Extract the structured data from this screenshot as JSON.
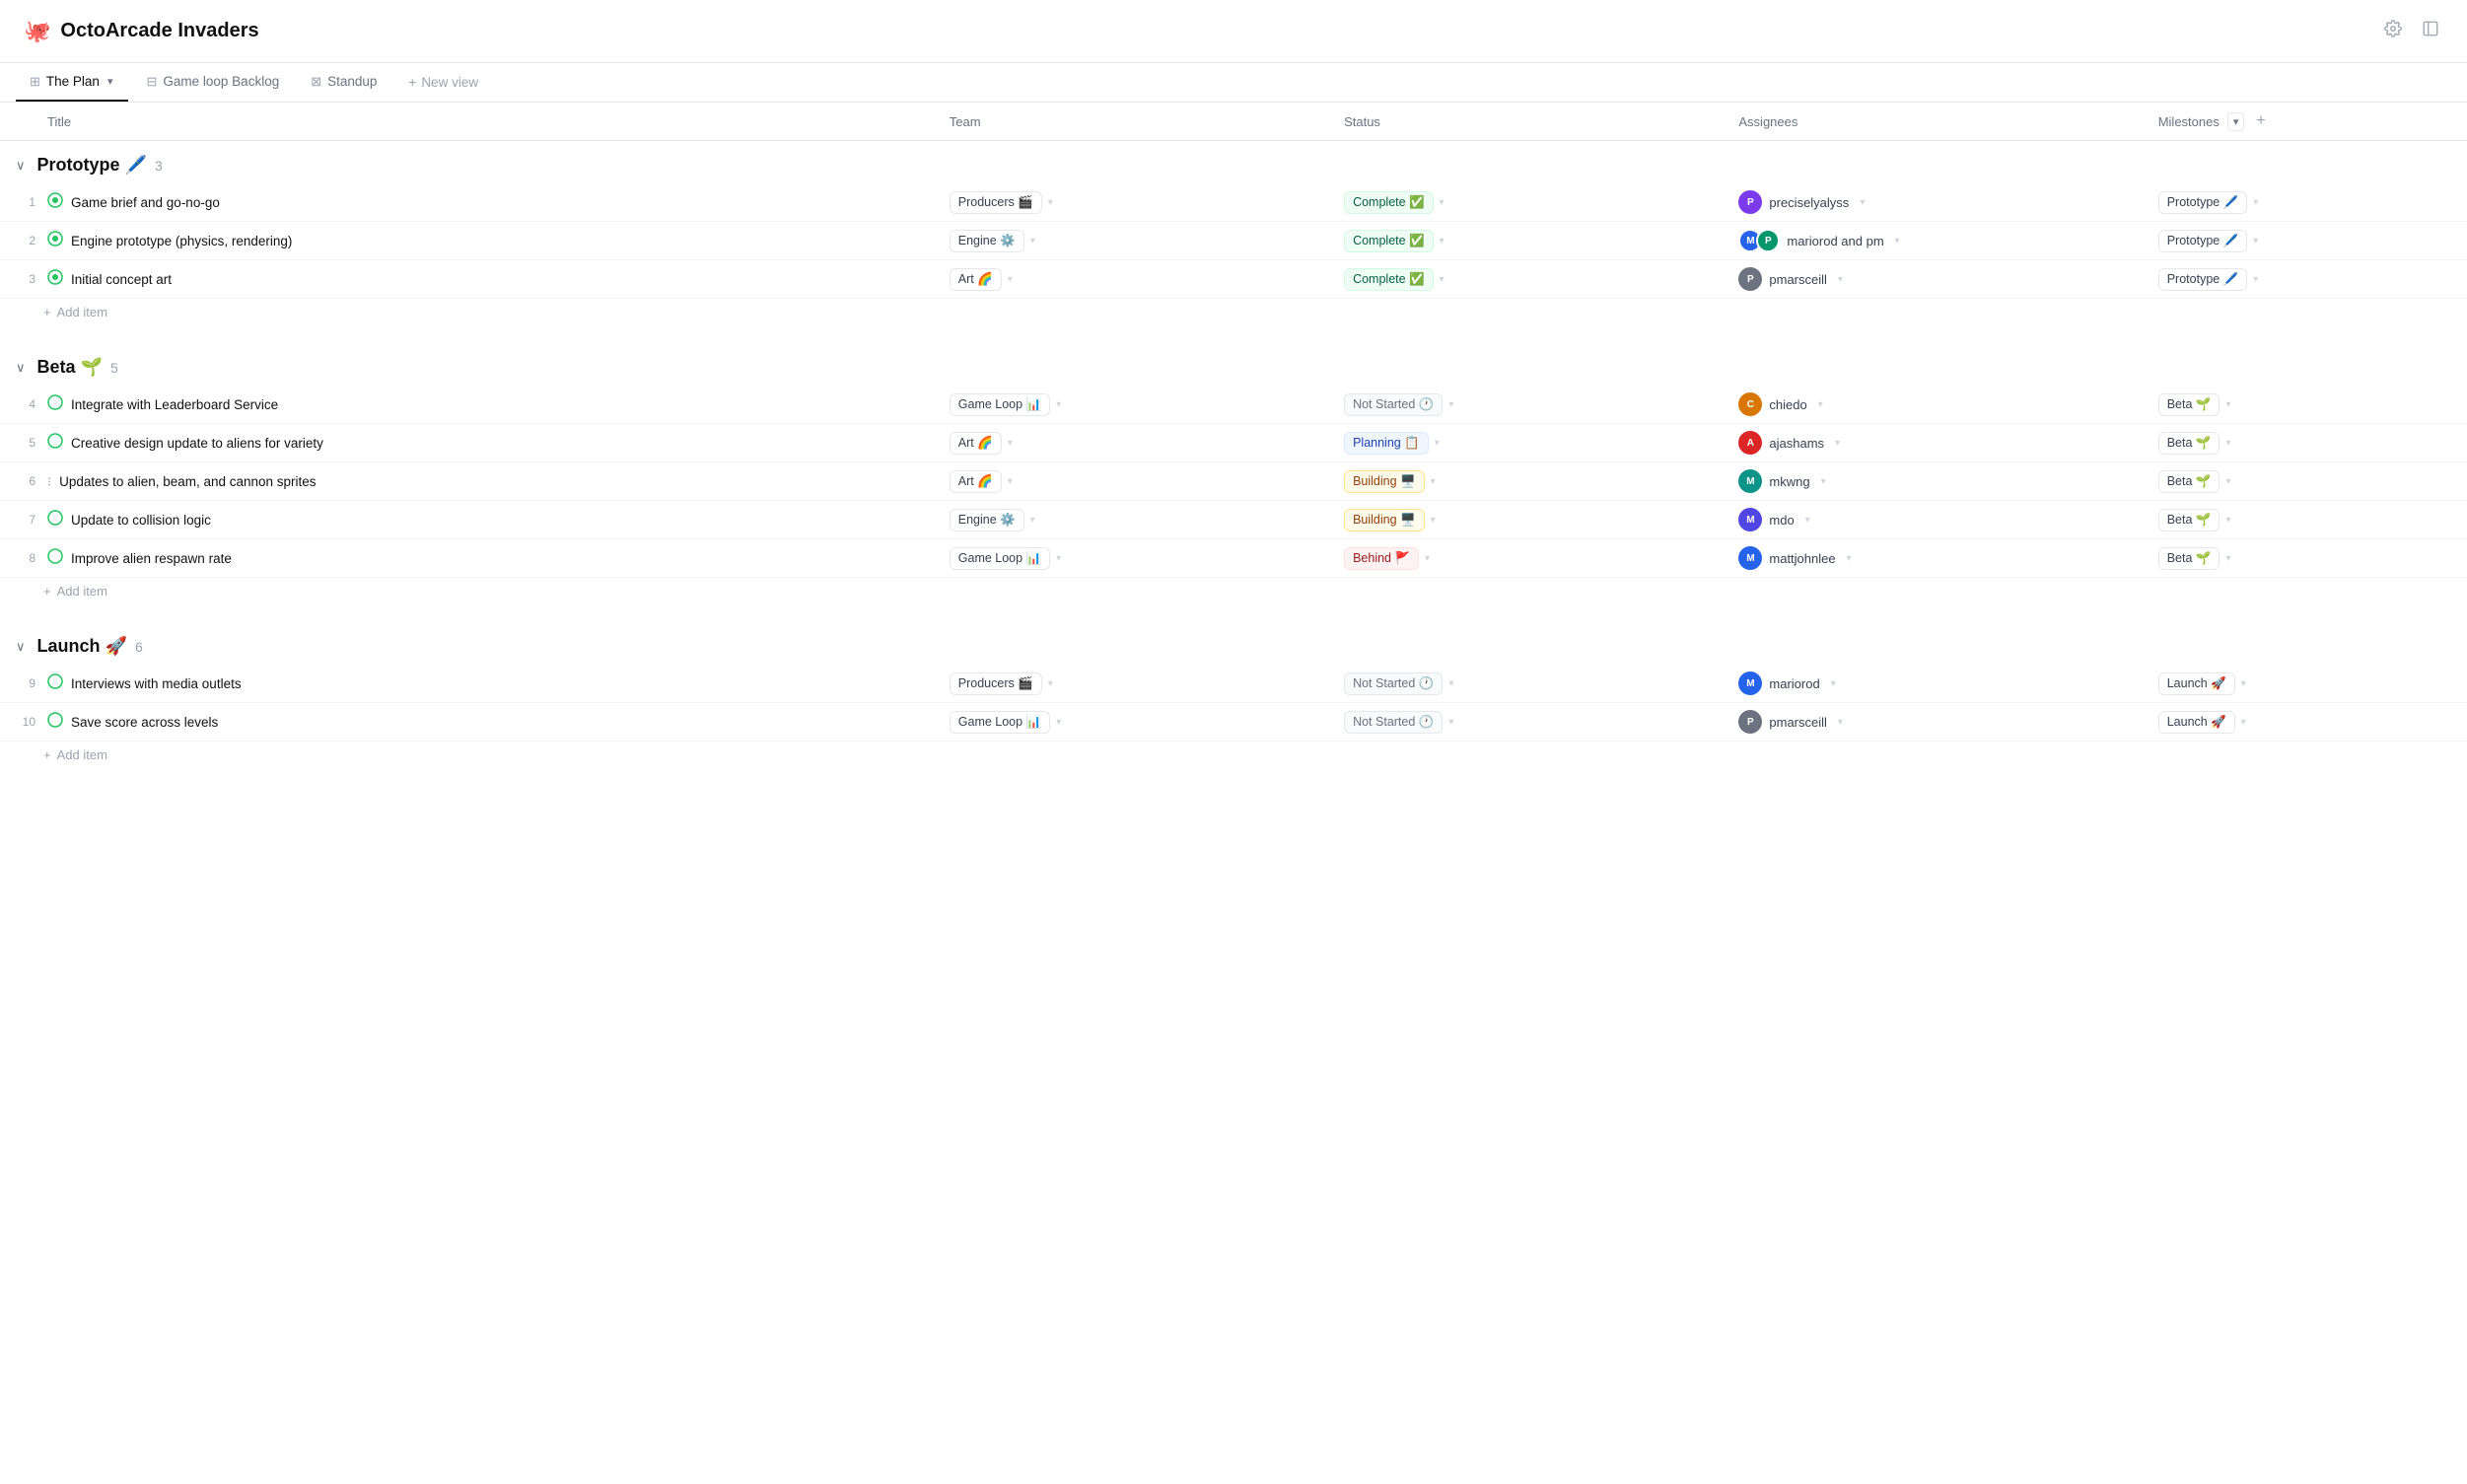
{
  "app": {
    "title": "OctoArcade Invaders",
    "icon": "🐙"
  },
  "tabs": [
    {
      "id": "plan",
      "label": "The Plan",
      "icon": "▦",
      "active": true,
      "hasDropdown": true
    },
    {
      "id": "backlog",
      "label": "Game loop Backlog",
      "icon": "▤",
      "active": false,
      "hasDropdown": false
    },
    {
      "id": "standup",
      "label": "Standup",
      "icon": "▥",
      "active": false,
      "hasDropdown": false
    },
    {
      "id": "newview",
      "label": "New view",
      "icon": "+",
      "active": false,
      "hasDropdown": false
    }
  ],
  "columns": {
    "title": "Title",
    "team": "Team",
    "status": "Status",
    "assignees": "Assignees",
    "milestones": "Milestones"
  },
  "groups": [
    {
      "id": "prototype",
      "name": "Prototype",
      "emoji": "🖊️",
      "count": 3,
      "items": [
        {
          "num": 1,
          "statusIcon": "⊙",
          "statusClass": "complete-icon",
          "title": "Game brief and go-no-go",
          "team": "Producers 🎬",
          "status": "Complete ✅",
          "statusClass2": "status-complete",
          "assignees": [
            {
              "initials": "P",
              "color": "av-purple"
            }
          ],
          "assigneeName": "preciselyalyss",
          "milestone": "Prototype 🖊️"
        },
        {
          "num": 2,
          "statusIcon": "⊙",
          "statusClass": "complete-icon",
          "title": "Engine prototype (physics, rendering)",
          "team": "Engine ⚙️",
          "status": "Complete ✅",
          "statusClass2": "status-complete",
          "assignees": [
            {
              "initials": "M",
              "color": "av-blue"
            },
            {
              "initials": "P",
              "color": "av-green"
            }
          ],
          "assigneeName": "mariorod and pm",
          "milestone": "Prototype 🖊️"
        },
        {
          "num": 3,
          "statusIcon": "⊙",
          "statusClass": "complete-icon",
          "title": "Initial concept art",
          "team": "Art 🌈",
          "status": "Complete ✅",
          "statusClass2": "status-complete",
          "assignees": [
            {
              "initials": "P",
              "color": "av-gray"
            }
          ],
          "assigneeName": "pmarsceill",
          "milestone": "Prototype 🖊️"
        }
      ]
    },
    {
      "id": "beta",
      "name": "Beta",
      "emoji": "🌱",
      "count": 5,
      "items": [
        {
          "num": 4,
          "statusIcon": "◎",
          "title": "Integrate with Leaderboard Service",
          "team": "Game Loop 📊",
          "status": "Not Started 🕐",
          "statusClass2": "status-not-started",
          "assignees": [
            {
              "initials": "C",
              "color": "av-orange"
            }
          ],
          "assigneeName": "chiedo",
          "milestone": "Beta 🌱"
        },
        {
          "num": 5,
          "statusIcon": "◎",
          "title": "Creative design update to aliens for variety",
          "team": "Art 🌈",
          "status": "Planning 📋",
          "statusClass2": "status-planning",
          "assignees": [
            {
              "initials": "A",
              "color": "av-red"
            }
          ],
          "assigneeName": "ajashams",
          "milestone": "Beta 🌱"
        },
        {
          "num": 6,
          "statusIcon": "⁝⁝",
          "title": "Updates to alien, beam, and cannon sprites",
          "team": "Art 🌈",
          "status": "Building 🖥️",
          "statusClass2": "status-building",
          "assignees": [
            {
              "initials": "M",
              "color": "av-teal"
            }
          ],
          "assigneeName": "mkwng",
          "milestone": "Beta 🌱"
        },
        {
          "num": 7,
          "statusIcon": "◎",
          "title": "Update to collision logic",
          "team": "Engine ⚙️",
          "status": "Building 🖥️",
          "statusClass2": "status-building",
          "assignees": [
            {
              "initials": "M",
              "color": "av-indigo"
            }
          ],
          "assigneeName": "mdo",
          "milestone": "Beta 🌱"
        },
        {
          "num": 8,
          "statusIcon": "◎",
          "title": "Improve alien respawn rate",
          "team": "Game Loop 📊",
          "status": "Behind 🚩",
          "statusClass2": "status-behind",
          "assignees": [
            {
              "initials": "M",
              "color": "av-blue"
            }
          ],
          "assigneeName": "mattjohnlee",
          "milestone": "Beta 🌱"
        }
      ]
    },
    {
      "id": "launch",
      "name": "Launch",
      "emoji": "🚀",
      "count": 6,
      "items": [
        {
          "num": 9,
          "statusIcon": "◎",
          "title": "Interviews with media outlets",
          "team": "Producers 🎬",
          "status": "Not Started 🕐",
          "statusClass2": "status-not-started",
          "assignees": [
            {
              "initials": "M",
              "color": "av-blue"
            }
          ],
          "assigneeName": "mariorod",
          "milestone": "Launch 🚀"
        },
        {
          "num": 10,
          "statusIcon": "◎",
          "title": "Save score across levels",
          "team": "Game Loop 📊",
          "status": "Not Started 🕐",
          "statusClass2": "status-not-started",
          "assignees": [
            {
              "initials": "P",
              "color": "av-gray"
            }
          ],
          "assigneeName": "pmarsceill",
          "milestone": "Launch 🚀"
        }
      ]
    }
  ],
  "labels": {
    "add_item": "Add item",
    "new_view": "New view"
  }
}
